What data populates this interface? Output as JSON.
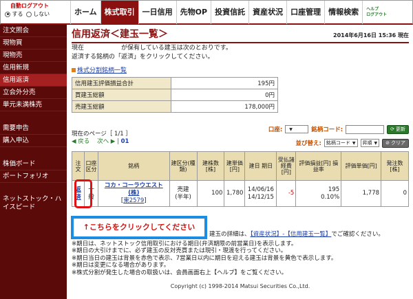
{
  "autologout": {
    "title": "自動ログアウト",
    "on_label": "する",
    "off_label": "しない"
  },
  "nav": {
    "home": "ホーム",
    "stock": "株式取引",
    "day_credit": "一日信用",
    "futures": "先物OP",
    "trust": "投資信託",
    "assets": "資産状況",
    "account": "口座管理",
    "info": "情報検索",
    "help_top": "ヘルプ",
    "help_bottom": "ログアウト"
  },
  "sidebar": {
    "items": [
      "注文照会",
      "現物買",
      "現物売",
      "信用新規",
      "信用返済",
      "立会外分売",
      "単元未満株売"
    ],
    "items2": [
      "需要申告",
      "購入申込"
    ],
    "items3": [
      "株価ボード",
      "ポートフォリオ"
    ],
    "netstock": "ネットストック・ハイスピード"
  },
  "page": {
    "title": "信用返済＜建玉一覧＞",
    "datetime": "2014年6月16日 15:36 現在",
    "desc1": "現在　　　　　　が保有している建玉は次のとおりです。",
    "desc2": "返済する銘柄の「返済」をクリックしてください。",
    "split_link": "株式分割銘柄一覧"
  },
  "summary": {
    "rows": [
      {
        "label": "信用建玉評価損益合計",
        "value": "195円"
      },
      {
        "label": "買建玉総額",
        "value": "0円"
      },
      {
        "label": "売建玉総額",
        "value": "178,000円"
      }
    ]
  },
  "pager": {
    "current": "現在のページ［ 1/1 ］",
    "prev": "◀ 戻る",
    "next": "次へ ▶",
    "page_num": "01"
  },
  "filters": {
    "account_label": "口座:",
    "code_label": "銘柄コード:",
    "refresh": "更新",
    "sort_label": "並び替え:",
    "sort_value": "銘柄コード",
    "order_value": "昇順",
    "clear": "クリア"
  },
  "table": {
    "headers": [
      "注文",
      "口座区分",
      "銘柄",
      "建区分(種類)",
      "建株数[株]",
      "建単価[円]",
      "建日 期日",
      "受払諸経費[円]",
      "評価損益[円] 損益率",
      "評価単価[円]",
      "発注数[株]"
    ],
    "row": {
      "repay_top": "返",
      "repay_bottom": "済",
      "account": "一般",
      "stock_name": "コカ・コーラウエスト(株)",
      "stock_code": "東2579",
      "type_top": "売建",
      "type_bottom": "(半年)",
      "shares": "100",
      "price": "1,780",
      "date_open": "14/06/16",
      "date_due": "14/12/15",
      "fees": "-5",
      "pl": "195",
      "pl_rate": "0.10%",
      "eval_price": "1,778",
      "order_qty": "0"
    }
  },
  "notes": {
    "line0_pre": "建玉の詳細は、",
    "line0_link": "【資産状況】-【信用建玉一覧】",
    "line0_post": "でご確認ください。",
    "line1": "※期日は、ネットストック信用取引における期日(弁済期限の前営業日)を表示します。",
    "line2": "※期日の大引けまでに、必ず建玉の反対売買または現引・現渡を行ってください。",
    "line3": "※期日当日の建玉は背景を赤色で表示、7営業日以内に期日を迎える建玉は背景を黄色で表示します。",
    "line4": "※期日は変更になる場合があります。",
    "line5": "※株式分割が発生した場合の取扱いは、会員画面右上【ヘルプ】をご覧ください。"
  },
  "callout": "↑こちらをクリックしてください",
  "copyright": "Copyright (c) 1998-2014 Matsui Securities Co.,Ltd."
}
